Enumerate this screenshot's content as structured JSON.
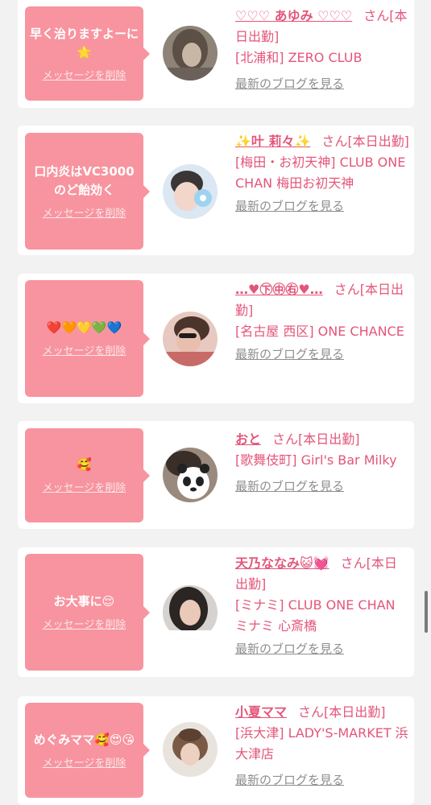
{
  "delete_label": "メッセージを削除",
  "blog_label": "最新のブログを見る",
  "san": "さん",
  "cards": [
    {
      "message": "早く治りますよーに🌟",
      "name": "♡♡♡ あゆみ ♡♡♡",
      "status": "[本日出勤]",
      "shop": "[北浦和] ZERO CLUB"
    },
    {
      "message": "口内炎はVC3000のど飴効く",
      "name": "✨叶 莉々✨",
      "status": "[本日出勤]",
      "shop": "[梅田・お初天神] CLUB ONE CHAN 梅田お初天神"
    },
    {
      "message": "❤️🧡💛💚💙",
      "name": "…♥㊦㊥㊨♥…",
      "status": "[本日出勤]",
      "shop": "[名古屋 西区] ONE CHANCE"
    },
    {
      "message": "🥰",
      "name": "おと",
      "status": "[本日出勤]",
      "shop": "[歌舞伎町] Girl's Bar Milky"
    },
    {
      "message": "お大事に😌",
      "name": "天乃ななみ😺💓",
      "status": "[本日出勤]",
      "shop": "[ミナミ] CLUB ONE CHAN ミナミ 心斎橋"
    },
    {
      "message": "めぐみママ🥰😍😘",
      "name": "小夏ママ",
      "status": "[本日出勤]",
      "shop": "[浜大津] LADY'S-MARKET 浜大津店"
    }
  ],
  "colors": {
    "background": "#f2f2f2",
    "bubble": "#f7949f",
    "accent_text": "#e4557a",
    "link_gray": "#8e8e8e"
  }
}
